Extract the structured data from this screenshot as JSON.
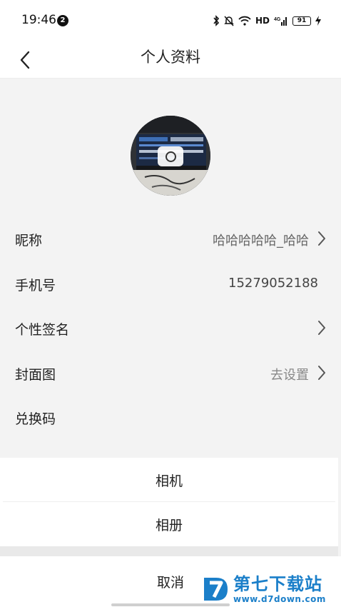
{
  "status_bar": {
    "time": "19:46",
    "notification_count": "2",
    "network_label": "HD",
    "signal_label": "4G",
    "battery": "91"
  },
  "header": {
    "title": "个人资料"
  },
  "profile": {
    "rows": [
      {
        "label": "昵称",
        "value": "哈哈哈哈哈_哈哈"
      },
      {
        "label": "手机号",
        "value": "15279052188"
      },
      {
        "label": "个性签名",
        "value": ""
      },
      {
        "label": "封面图",
        "value": "去设置"
      },
      {
        "label": "兑换码",
        "value": ""
      }
    ]
  },
  "action_sheet": {
    "camera_label": "相机",
    "album_label": "相册",
    "cancel_label": "取消"
  },
  "watermark": {
    "title": "第七下载站",
    "url": "www.d7down.com"
  },
  "colors": {
    "accent": "#1b7fc9",
    "background": "#f3f3f3",
    "surface": "#ffffff"
  }
}
